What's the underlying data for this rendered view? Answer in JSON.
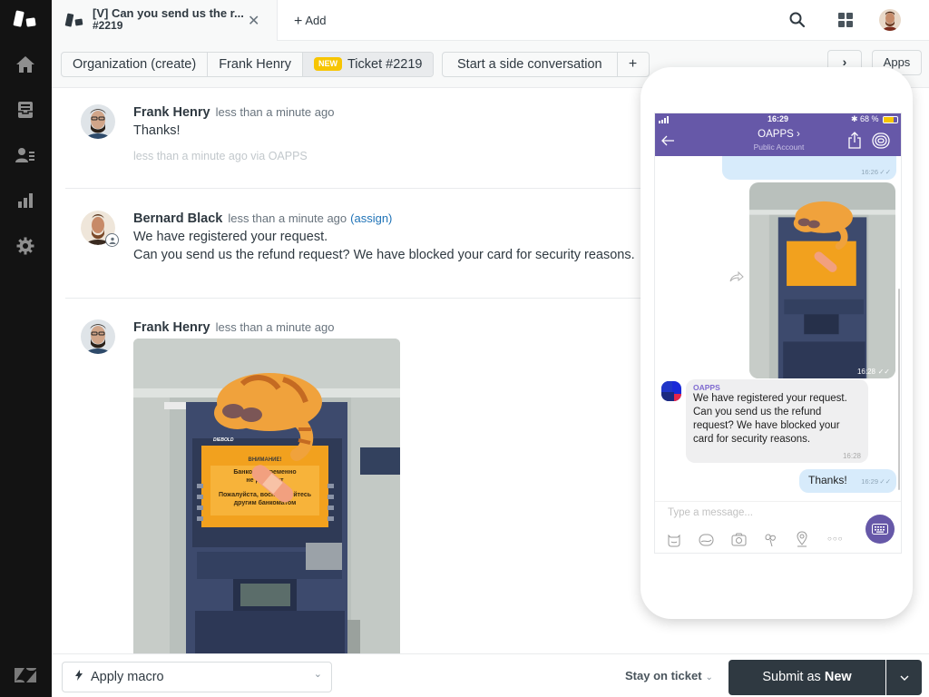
{
  "colors": {
    "sidebar_bg": "#131313",
    "viber_purple": "#6658a8",
    "submit_bg": "#2f3941",
    "new_badge": "#f7c502",
    "link_blue": "#1f73b7"
  },
  "sidebar": {
    "items": [
      {
        "icon": "home-icon",
        "label": "Home"
      },
      {
        "icon": "views-icon",
        "label": "Views"
      },
      {
        "icon": "customers-icon",
        "label": "Customers"
      },
      {
        "icon": "reporting-icon",
        "label": "Reporting"
      },
      {
        "icon": "gear-icon",
        "label": "Admin"
      }
    ]
  },
  "topbar": {
    "ticket_tab": {
      "title": "[V] Can you send us the r...",
      "subtitle": "#2219"
    },
    "add_label": "Add"
  },
  "subheader": {
    "breadcrumbs": [
      {
        "label": "Organization (create)"
      },
      {
        "label": "Frank Henry"
      },
      {
        "badge": "NEW",
        "label": "Ticket #2219"
      }
    ],
    "side_conversation": "Start a side conversation",
    "side_conversation_add": "+",
    "apps": "Apps"
  },
  "conversation": {
    "comments": [
      {
        "author": "Frank Henry",
        "time": "less than a minute ago",
        "body": [
          "Thanks!"
        ],
        "via": "less than a minute ago via OAPPS"
      },
      {
        "author": "Bernard Black",
        "time": "less than a minute ago",
        "assign": "(assign)",
        "body": [
          "We have registered your request.",
          "Can you send us the refund request? We have blocked your card for security reasons."
        ]
      },
      {
        "author": "Frank Henry",
        "time": "less than a minute ago",
        "attachment": "atm-photo-with-cat-sticker",
        "atm_screen_text": [
          "ВНИМАНИЕ!",
          "Банкомат временно",
          "не работает",
          "Пожалуйста, воспользуйтесь",
          "другим банкоматом"
        ],
        "atm_brand": "DIEBOLD"
      }
    ]
  },
  "phone": {
    "status": {
      "time": "16:29",
      "battery": "68 %"
    },
    "header": {
      "title": "OAPPS ›",
      "subtitle": "Public Account"
    },
    "messages": [
      {
        "type": "outgoing",
        "time": "16:26"
      },
      {
        "type": "outgoing-image",
        "time": "16:28"
      },
      {
        "type": "incoming",
        "sender": "OAPPS",
        "text": [
          "We have registered your request.",
          "Can you send us the refund",
          "request? We have blocked your",
          "card for security reasons."
        ],
        "time": "16:28"
      },
      {
        "type": "outgoing",
        "text": "Thanks!",
        "time": "16:29"
      }
    ],
    "compose_placeholder": "Type a message..."
  },
  "footer": {
    "macro": "Apply macro",
    "stay": "Stay on ticket",
    "submit_prefix": "Submit as",
    "submit_status": "New"
  }
}
